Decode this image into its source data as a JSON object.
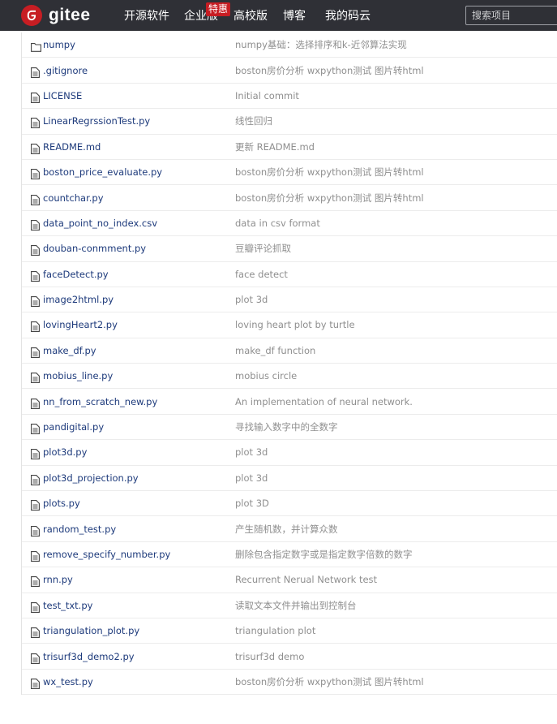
{
  "header": {
    "logo_text": "gitee",
    "nav": [
      {
        "label": "开源软件"
      },
      {
        "label": "企业版"
      },
      {
        "label": "高校版"
      },
      {
        "label": "博客"
      },
      {
        "label": "我的码云"
      }
    ],
    "hot_badge": "特惠",
    "search_placeholder": "搜索项目",
    "brand_color": "#c71d23",
    "bar_color": "#2f3036"
  },
  "files": [
    {
      "icon": "folder-icon",
      "name": "numpy",
      "message": "numpy基础：选择排序和k-近邻算法实现"
    },
    {
      "icon": "file-icon",
      "name": ".gitignore",
      "message": "boston房价分析 wxpython测试 图片转html"
    },
    {
      "icon": "file-icon",
      "name": "LICENSE",
      "message": "Initial commit"
    },
    {
      "icon": "file-icon",
      "name": "LinearRegrssionTest.py",
      "message": "线性回归"
    },
    {
      "icon": "file-icon",
      "name": "README.md",
      "message": "更新 README.md"
    },
    {
      "icon": "file-icon",
      "name": "boston_price_evaluate.py",
      "message": "boston房价分析 wxpython测试 图片转html"
    },
    {
      "icon": "file-icon",
      "name": "countchar.py",
      "message": "boston房价分析 wxpython测试 图片转html"
    },
    {
      "icon": "file-icon",
      "name": "data_point_no_index.csv",
      "message": "data in csv format"
    },
    {
      "icon": "file-icon",
      "name": "douban-conmment.py",
      "message": "豆瓣评论抓取"
    },
    {
      "icon": "file-icon",
      "name": "faceDetect.py",
      "message": "face detect"
    },
    {
      "icon": "file-icon",
      "name": "image2html.py",
      "message": "plot 3d"
    },
    {
      "icon": "file-icon",
      "name": "lovingHeart2.py",
      "message": "loving heart plot by turtle"
    },
    {
      "icon": "file-icon",
      "name": "make_df.py",
      "message": "make_df function"
    },
    {
      "icon": "file-icon",
      "name": "mobius_line.py",
      "message": "mobius circle"
    },
    {
      "icon": "file-icon",
      "name": "nn_from_scratch_new.py",
      "message": "An implementation of neural network."
    },
    {
      "icon": "file-icon",
      "name": "pandigital.py",
      "message": "寻找输入数字中的全数字"
    },
    {
      "icon": "file-icon",
      "name": "plot3d.py",
      "message": "plot 3d"
    },
    {
      "icon": "file-icon",
      "name": "plot3d_projection.py",
      "message": "plot 3d"
    },
    {
      "icon": "file-icon",
      "name": "plots.py",
      "message": "plot 3D"
    },
    {
      "icon": "file-icon",
      "name": "random_test.py",
      "message": "产生随机数，并计算众数"
    },
    {
      "icon": "file-icon",
      "name": "remove_specify_number.py",
      "message": "删除包含指定数字或是指定数字倍数的数字"
    },
    {
      "icon": "file-icon",
      "name": "rnn.py",
      "message": "Recurrent Nerual Network test"
    },
    {
      "icon": "file-icon",
      "name": "test_txt.py",
      "message": "读取文本文件并输出到控制台"
    },
    {
      "icon": "file-icon",
      "name": "triangulation_plot.py",
      "message": "triangulation plot"
    },
    {
      "icon": "file-icon",
      "name": "trisurf3d_demo2.py",
      "message": "trisurf3d demo"
    },
    {
      "icon": "file-icon",
      "name": "wx_test.py",
      "message": "boston房价分析 wxpython测试 图片转html"
    }
  ]
}
